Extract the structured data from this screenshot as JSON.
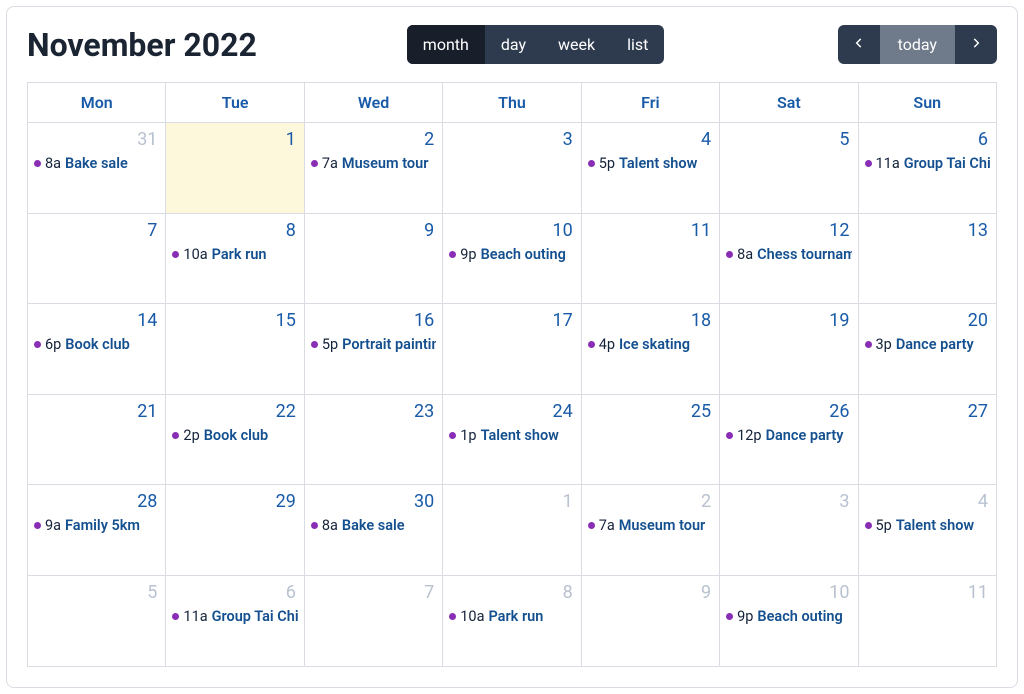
{
  "header": {
    "title": "November 2022",
    "views": {
      "month": "month",
      "day": "day",
      "week": "week",
      "list": "list"
    },
    "nav": {
      "today": "today"
    }
  },
  "dayHeaders": [
    "Mon",
    "Tue",
    "Wed",
    "Thu",
    "Fri",
    "Sat",
    "Sun"
  ],
  "weeks": [
    [
      {
        "n": "31",
        "other": true,
        "events": [
          {
            "time": "8a",
            "title": "Bake sale"
          }
        ]
      },
      {
        "n": "1",
        "today": true,
        "events": []
      },
      {
        "n": "2",
        "events": [
          {
            "time": "7a",
            "title": "Museum tour"
          }
        ]
      },
      {
        "n": "3",
        "events": []
      },
      {
        "n": "4",
        "events": [
          {
            "time": "5p",
            "title": "Talent show"
          }
        ]
      },
      {
        "n": "5",
        "events": []
      },
      {
        "n": "6",
        "events": [
          {
            "time": "11a",
            "title": "Group Tai Chi"
          }
        ]
      }
    ],
    [
      {
        "n": "7",
        "events": []
      },
      {
        "n": "8",
        "events": [
          {
            "time": "10a",
            "title": "Park run"
          }
        ]
      },
      {
        "n": "9",
        "events": []
      },
      {
        "n": "10",
        "events": [
          {
            "time": "9p",
            "title": "Beach outing"
          }
        ]
      },
      {
        "n": "11",
        "events": []
      },
      {
        "n": "12",
        "events": [
          {
            "time": "8a",
            "title": "Chess tournament"
          }
        ]
      },
      {
        "n": "13",
        "events": []
      }
    ],
    [
      {
        "n": "14",
        "events": [
          {
            "time": "6p",
            "title": "Book club"
          }
        ]
      },
      {
        "n": "15",
        "events": []
      },
      {
        "n": "16",
        "events": [
          {
            "time": "5p",
            "title": "Portrait painting"
          }
        ]
      },
      {
        "n": "17",
        "events": []
      },
      {
        "n": "18",
        "events": [
          {
            "time": "4p",
            "title": "Ice skating"
          }
        ]
      },
      {
        "n": "19",
        "events": []
      },
      {
        "n": "20",
        "events": [
          {
            "time": "3p",
            "title": "Dance party"
          }
        ]
      }
    ],
    [
      {
        "n": "21",
        "events": []
      },
      {
        "n": "22",
        "events": [
          {
            "time": "2p",
            "title": "Book club"
          }
        ]
      },
      {
        "n": "23",
        "events": []
      },
      {
        "n": "24",
        "events": [
          {
            "time": "1p",
            "title": "Talent show"
          }
        ]
      },
      {
        "n": "25",
        "events": []
      },
      {
        "n": "26",
        "events": [
          {
            "time": "12p",
            "title": "Dance party"
          }
        ]
      },
      {
        "n": "27",
        "events": []
      }
    ],
    [
      {
        "n": "28",
        "events": [
          {
            "time": "9a",
            "title": "Family 5km"
          }
        ]
      },
      {
        "n": "29",
        "events": []
      },
      {
        "n": "30",
        "events": [
          {
            "time": "8a",
            "title": "Bake sale"
          }
        ]
      },
      {
        "n": "1",
        "other": true,
        "events": []
      },
      {
        "n": "2",
        "other": true,
        "events": [
          {
            "time": "7a",
            "title": "Museum tour"
          }
        ]
      },
      {
        "n": "3",
        "other": true,
        "events": []
      },
      {
        "n": "4",
        "other": true,
        "events": [
          {
            "time": "5p",
            "title": "Talent show"
          }
        ]
      }
    ],
    [
      {
        "n": "5",
        "other": true,
        "events": []
      },
      {
        "n": "6",
        "other": true,
        "events": [
          {
            "time": "11a",
            "title": "Group Tai Chi"
          }
        ]
      },
      {
        "n": "7",
        "other": true,
        "events": []
      },
      {
        "n": "8",
        "other": true,
        "events": [
          {
            "time": "10a",
            "title": "Park run"
          }
        ]
      },
      {
        "n": "9",
        "other": true,
        "events": []
      },
      {
        "n": "10",
        "other": true,
        "events": [
          {
            "time": "9p",
            "title": "Beach outing"
          }
        ]
      },
      {
        "n": "11",
        "other": true,
        "events": []
      }
    ]
  ]
}
